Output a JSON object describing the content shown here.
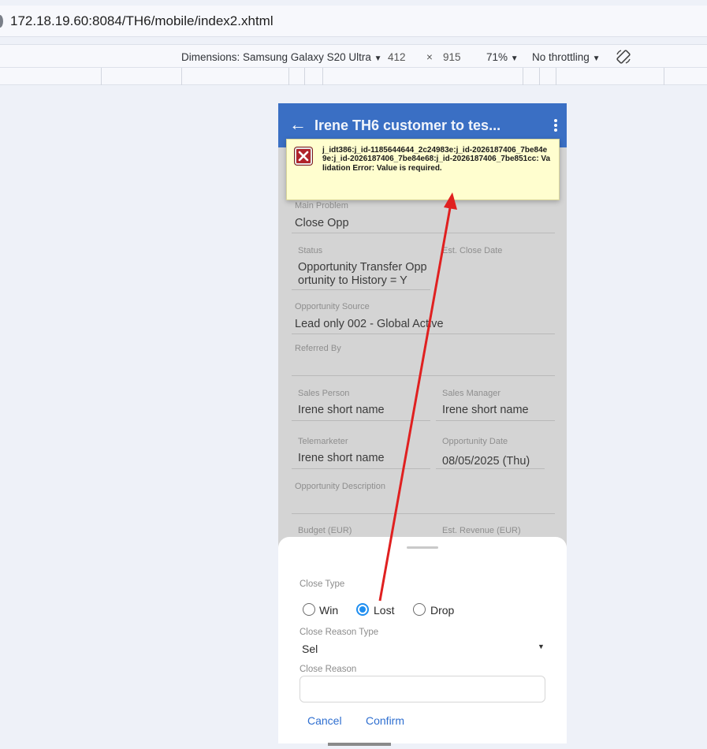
{
  "browser": {
    "url": "172.18.19.60:8084/TH6/mobile/index2.xhtml"
  },
  "devtools": {
    "dimensions_label": "Dimensions: Samsung Galaxy S20 Ultra",
    "width": "412",
    "times": "×",
    "height": "915",
    "zoom": "71%",
    "throttling": "No throttling",
    "caret": "▼"
  },
  "app": {
    "title": "Irene TH6 customer to tes...",
    "back_glyph": "←"
  },
  "error_toast": {
    "message": "j_idt386:j_id-1185644644_2c24983e:j_id-2026187406_7be84e9e:j_id-2026187406_7be84e68:j_id-2026187406_7be851cc: Validation Error: Value is required."
  },
  "form": {
    "main_problem_label": "Main Problem",
    "main_problem_value": "Close Opp",
    "status_label": "Status",
    "status_value_line1": "Opportunity Transfer Opp",
    "status_value_line2": "ortunity to History = Y",
    "est_close_date_label": "Est. Close Date",
    "opportunity_source_label": "Opportunity Source",
    "opportunity_source_value": "Lead only 002 - Global Active",
    "referred_by_label": "Referred By",
    "sales_person_label": "Sales Person",
    "sales_person_value": "Irene short name",
    "sales_manager_label": "Sales Manager",
    "sales_manager_value": "Irene short name",
    "telemarketer_label": "Telemarketer",
    "telemarketer_value": "Irene short name",
    "opportunity_date_label": "Opportunity Date",
    "opportunity_date_value": "08/05/2025 (Thu)",
    "opportunity_description_label": "Opportunity Description",
    "budget_label": "Budget (EUR)",
    "est_revenue_label": "Est. Revenue (EUR)"
  },
  "sheet": {
    "close_type_label": "Close Type",
    "options": [
      "Win",
      "Lost",
      "Drop"
    ],
    "selected_option": "Lost",
    "close_reason_type_label": "Close Reason Type",
    "close_reason_type_value": "Sel",
    "close_reason_label": "Close Reason",
    "close_reason_value": "",
    "cancel_label": "Cancel",
    "confirm_label": "Confirm"
  },
  "colors": {
    "appbar": "#3a6fc4",
    "radio_selected": "#1f8ef0",
    "annotation_arrow": "#e02020",
    "toast_bg": "#fffecf",
    "error_icon": "#b0232a"
  }
}
